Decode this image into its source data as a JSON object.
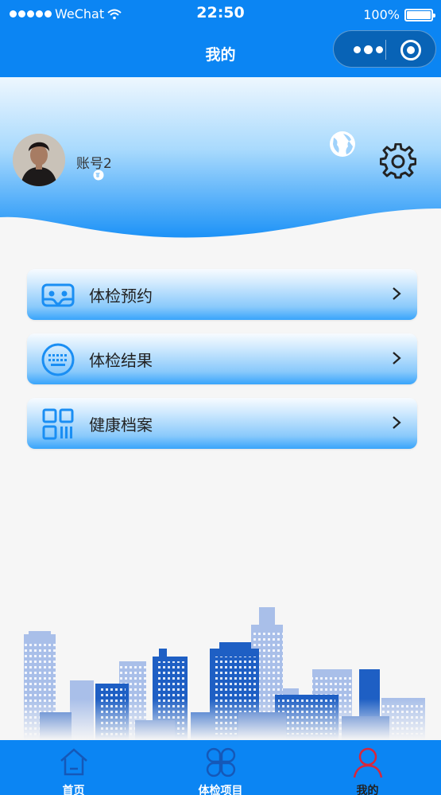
{
  "status_bar": {
    "carrier": "WeChat",
    "time": "22:50",
    "battery": "100%"
  },
  "nav": {
    "title": "我的"
  },
  "profile": {
    "account_name": "账号2"
  },
  "menu": [
    {
      "label": "体检预约",
      "icon": "vr-glasses-icon"
    },
    {
      "label": "体检结果",
      "icon": "keyboard-icon"
    },
    {
      "label": "健康档案",
      "icon": "qr-grid-icon"
    }
  ],
  "tabs": [
    {
      "label": "首页",
      "icon": "home-icon"
    },
    {
      "label": "体检项目",
      "icon": "clover-icon"
    },
    {
      "label": "我的",
      "icon": "user-icon",
      "active": true
    }
  ],
  "colors": {
    "brand_blue": "#0b85f3",
    "active_tab_icon": "#d9263a"
  }
}
